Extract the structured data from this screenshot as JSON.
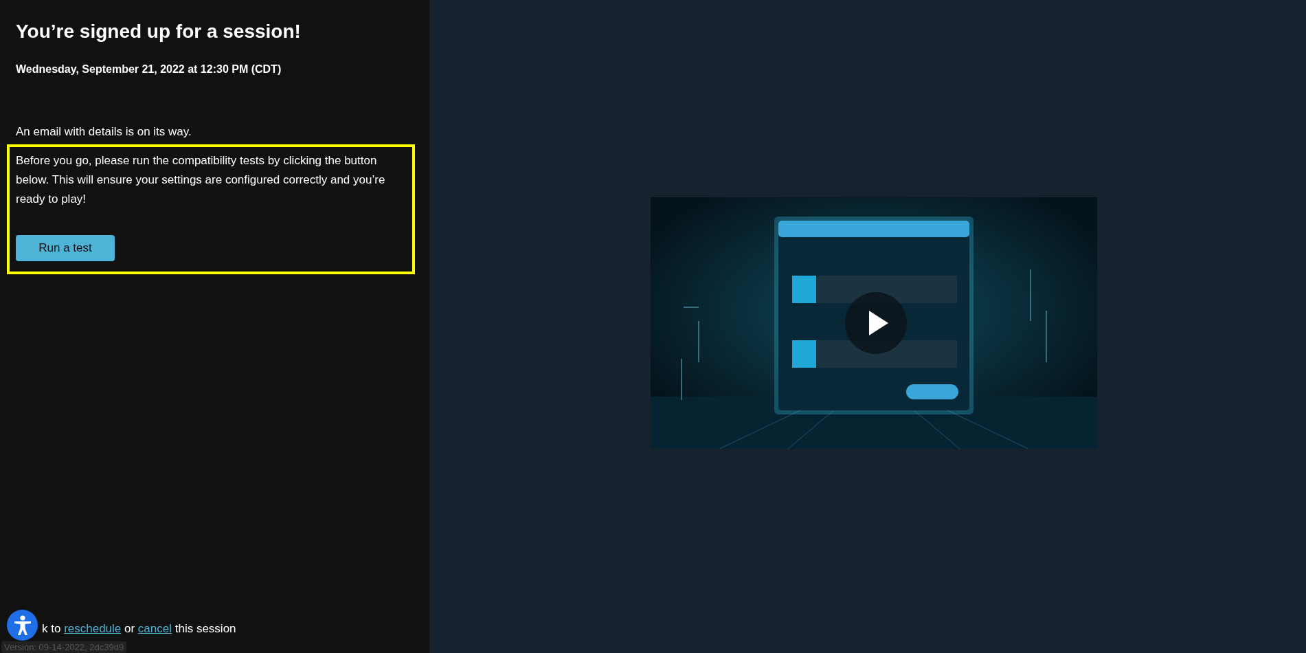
{
  "confirmation": {
    "title": "You’re signed up for a session!",
    "datetime": "Wednesday, September 21, 2022 at 12:30 PM (CDT)",
    "email_note": "An email with details is on its way.",
    "instructions": "Before you go, please run the compatibility tests by clicking the button below. This will ensure your settings are configured correctly and you’re ready to play!",
    "test_button": "Run a test"
  },
  "footer": {
    "parts": [
      {
        "kind": "text",
        "text": "k to "
      },
      {
        "kind": "link",
        "text": "reschedule"
      },
      {
        "kind": "text",
        "text": " or "
      },
      {
        "kind": "link",
        "text": "cancel"
      },
      {
        "kind": "text",
        "text": " this session"
      }
    ],
    "version": "Version: 09-14-2022, 2dc39d9"
  }
}
